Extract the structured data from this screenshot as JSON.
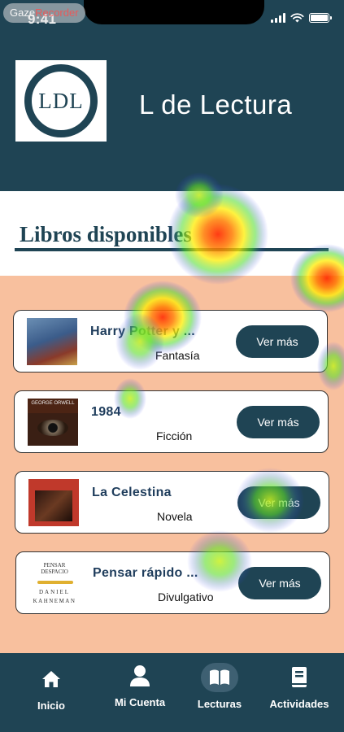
{
  "status_bar": {
    "time": "9:41",
    "recorder_badge_a": "Gaze",
    "recorder_badge_b": "Recorder"
  },
  "header": {
    "logo_text": "LDL",
    "title": "L de Lectura"
  },
  "section": {
    "title": "Libros disponibles"
  },
  "books": [
    {
      "title": "Harry Potter y ...",
      "genre": "Fantasía",
      "button": "Ver más"
    },
    {
      "title": "1984",
      "genre": "Ficción",
      "button": "Ver más",
      "cover_text": "GEORGE ORWELL"
    },
    {
      "title": "La Celestina",
      "genre": "Novela",
      "button": "Ver más"
    },
    {
      "title": "Pensar rápido ...",
      "genre": "Divulgativo",
      "button": "Ver más",
      "cover_title": "PENSAR DESPACIO",
      "cover_author_first": "DANIEL",
      "cover_author_last": "KAHNEMAN"
    }
  ],
  "tabs": [
    {
      "label": "Inicio",
      "icon": "home-icon"
    },
    {
      "label": "Mi Cuenta",
      "icon": "user-icon"
    },
    {
      "label": "Lecturas",
      "icon": "book-icon",
      "active": true
    },
    {
      "label": "Actividades",
      "icon": "notebook-icon"
    }
  ],
  "colors": {
    "primary": "#1f4454",
    "list_background": "#f8c09e",
    "title_text": "#1f3d5c"
  }
}
